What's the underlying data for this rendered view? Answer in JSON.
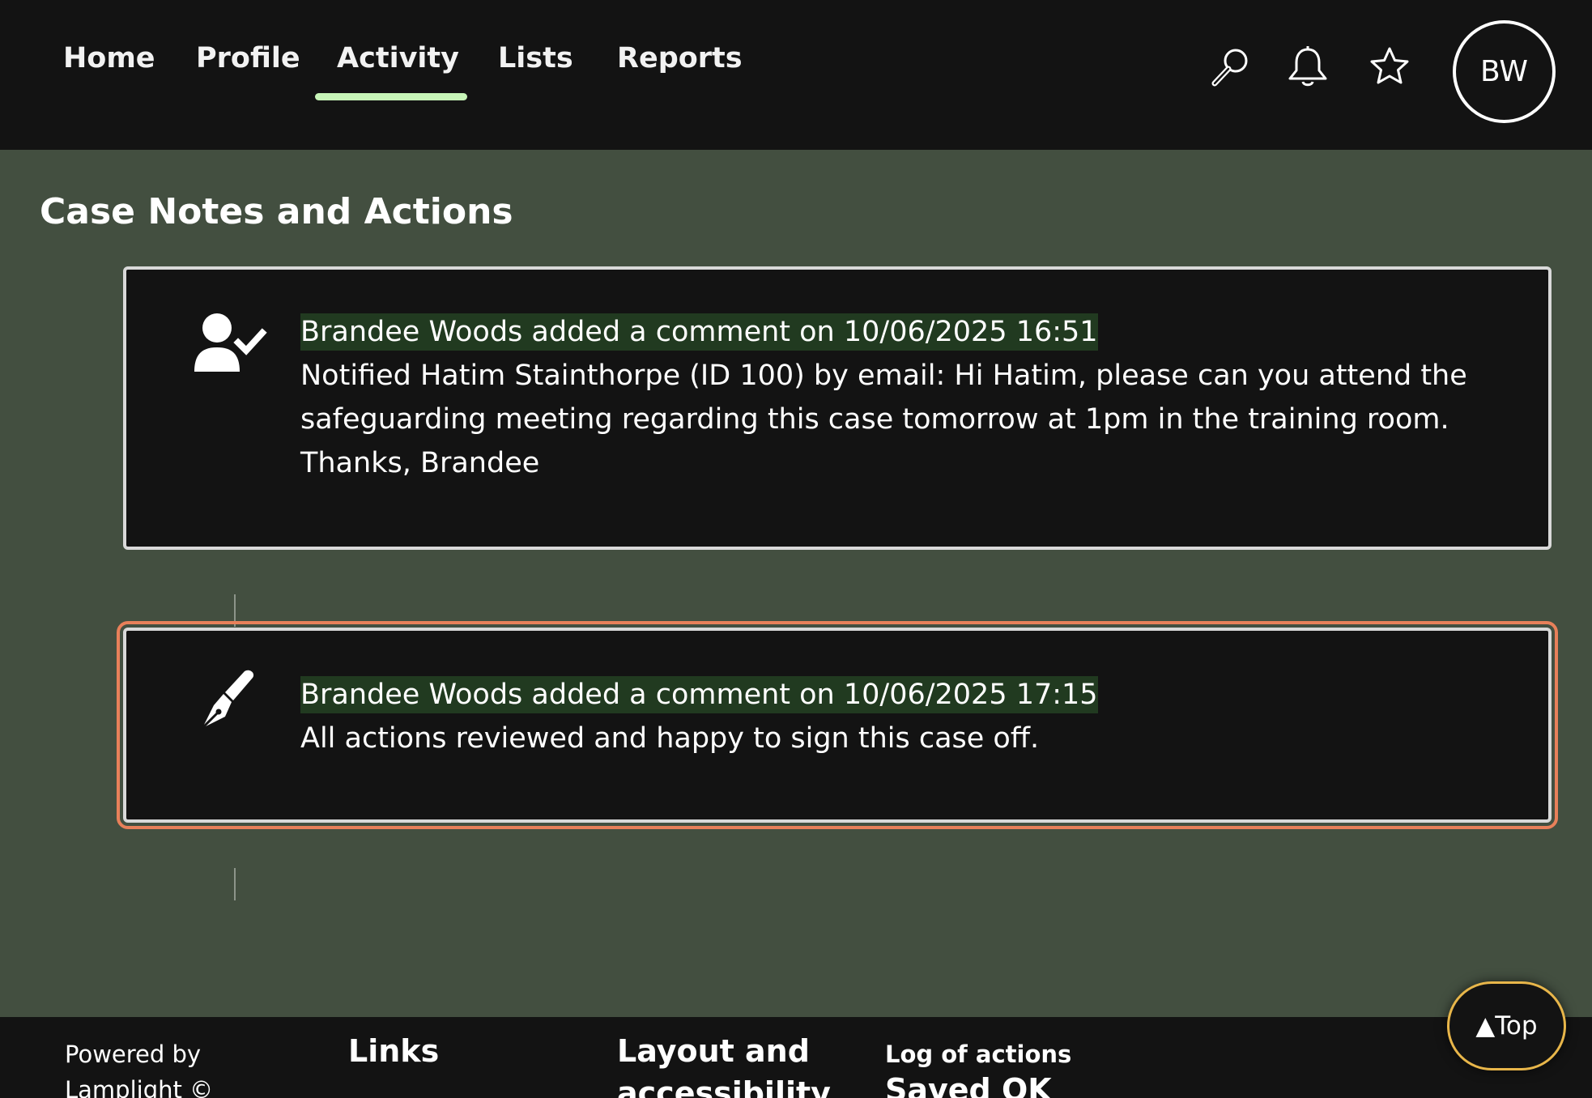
{
  "nav": {
    "items": [
      {
        "label": "Home"
      },
      {
        "label": "Profile"
      },
      {
        "label": "Activity"
      },
      {
        "label": "Lists"
      },
      {
        "label": "Reports"
      }
    ],
    "active_item": "Activity",
    "icons": [
      "search-icon",
      "bell-icon",
      "star-icon"
    ],
    "avatar_initials": "BW"
  },
  "main": {
    "title": "Case Notes and Actions",
    "entries": [
      {
        "icon": "user-check-icon",
        "header": "Brandee Woods added a comment on 10/06/2025 16:51",
        "body": "Notified Hatim Stainthorpe (ID 100) by email: Hi Hatim, please can you attend the safeguarding meeting regarding this case tomorrow at 1pm in the training room. Thanks, Brandee"
      },
      {
        "icon": "pen-icon",
        "header": "Brandee Woods added a comment on 10/06/2025 17:15",
        "body": "All actions reviewed and happy to sign this case off."
      }
    ]
  },
  "footer": {
    "powered_by": "Powered by Lamplight ©",
    "links_heading": "Links",
    "layout_heading": "Layout and accessibility",
    "log_label": "Log of actions",
    "log_status": "Saved OK"
  },
  "top_button": {
    "label": "▲Top"
  },
  "colors": {
    "background": "#434f40",
    "bar": "#131313",
    "active_underline": "#c7f5b8",
    "header_highlight": "#213a20",
    "focus_outline": "#e8805a",
    "top_button_border": "#e8b64a"
  }
}
